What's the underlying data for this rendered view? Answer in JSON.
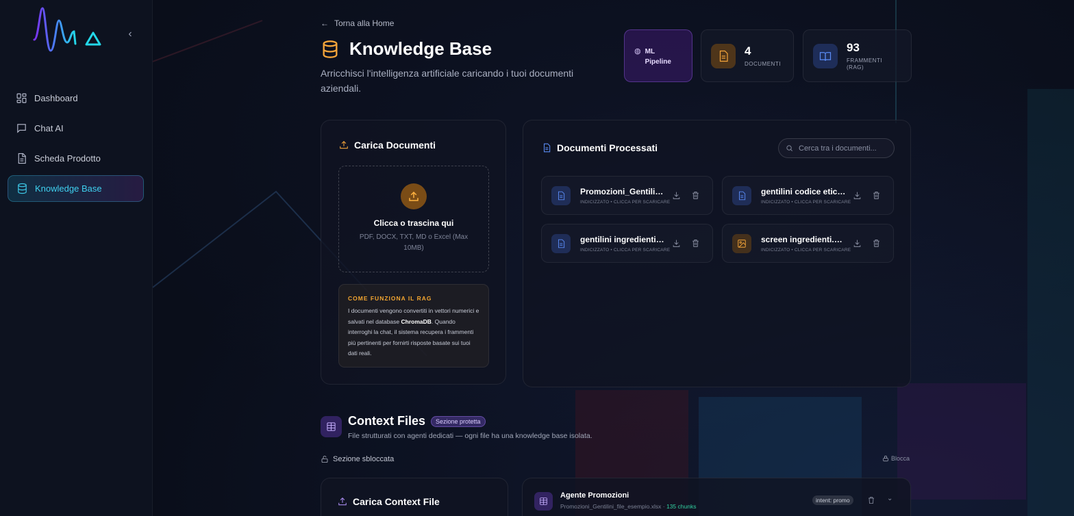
{
  "sidebar": {
    "items": [
      {
        "label": "Dashboard",
        "icon": "grid-icon"
      },
      {
        "label": "Chat AI",
        "icon": "chat-icon"
      },
      {
        "label": "Scheda Prodotto",
        "icon": "document-icon"
      },
      {
        "label": "Knowledge Base",
        "icon": "database-icon",
        "active": true
      }
    ]
  },
  "header": {
    "back_label": "Torna alla Home",
    "title": "Knowledge Base",
    "subtitle": "Arricchisci l'intelligenza artificiale caricando i tuoi documenti aziendali."
  },
  "stats": {
    "ml": {
      "line1": "ML",
      "line2": "Pipeline"
    },
    "docs": {
      "value": "4",
      "label": "DOCUMENTI"
    },
    "frag": {
      "value": "93",
      "label1": "FRAMMENTI",
      "label2": "(RAG)"
    }
  },
  "upload": {
    "title": "Carica Documenti",
    "drop_title": "Clicca o trascina qui",
    "drop_sub": "PDF, DOCX, TXT, MD o Excel (Max 10MB)",
    "rag_title": "COME FUNZIONA IL RAG",
    "rag_text_1": "I documenti vengono convertiti in vettori numerici e salvati nel database ",
    "rag_text_bold": "ChromaDB",
    "rag_text_2": ". Quando interroghi la chat, il sistema recupera i frammenti più pertinenti per fornirti risposte basate sui tuoi dati reali."
  },
  "documents": {
    "title": "Documenti Processati",
    "search_placeholder": "Cerca tra i documenti...",
    "items": [
      {
        "name": "Promozioni_Gentilini_file_esempio.xlsx",
        "status": "INDICIZZATO • CLICCA PER SCARICARE",
        "type": "doc"
      },
      {
        "name": "gentilini codice etico.pdf",
        "status": "INDICIZZATO • CLICCA PER SCARICARE",
        "type": "doc"
      },
      {
        "name": "gentilini ingredienti.pdf",
        "status": "INDICIZZATO • CLICCA PER SCARICARE",
        "type": "doc"
      },
      {
        "name": "screen ingredienti.png",
        "status": "INDICIZZATO • CLICCA PER SCARICARE",
        "type": "image"
      }
    ]
  },
  "context": {
    "title": "Context Files",
    "badge": "Sezione protetta",
    "subtitle": "File strutturati con agenti dedicati — ogni file ha una knowledge base isolata.",
    "unlocked_label": "Sezione sbloccata",
    "lock_label": "Blocca",
    "upload_title": "Carica Context File",
    "agent": {
      "name": "Agente Promozioni",
      "file": "Promozioni_Gentilini_file_esempio.xlsx · ",
      "chunks": "135 chunks",
      "intent": "intent: promo"
    }
  },
  "colors": {
    "accent_cyan": "#3fd0ef",
    "accent_orange": "#f5a53a",
    "accent_purple": "#8f6ae0",
    "accent_blue": "#5b8cf5",
    "success_green": "#31d0a0"
  }
}
